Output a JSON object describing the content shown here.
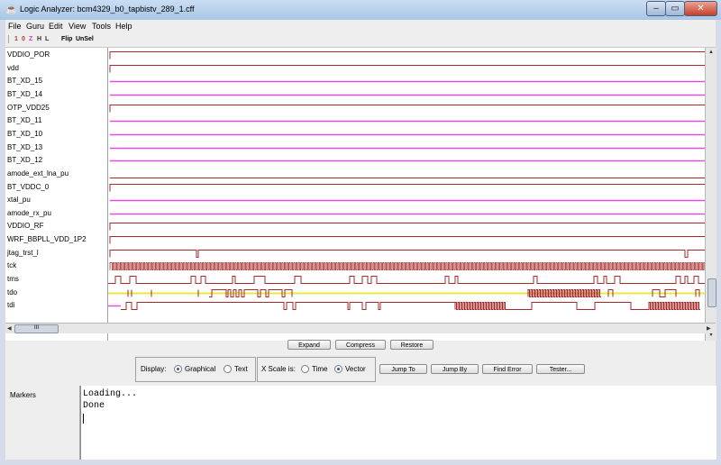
{
  "window": {
    "title": "Logic Analyzer: bcm4329_b0_tapbistv_289_1.cff",
    "controls": {
      "minimize": "‒",
      "maximize": "▭",
      "close": "✕"
    }
  },
  "menu": [
    "File",
    "Guru",
    "Edit",
    "View",
    "Tools",
    "Help"
  ],
  "toolbar": {
    "items": [
      {
        "label": "1",
        "color": "#b0392a"
      },
      {
        "label": "0",
        "color": "#b0392a"
      },
      {
        "label": "Z",
        "color": "#d040d0"
      },
      {
        "label": "H",
        "color": "#303030"
      },
      {
        "label": "L",
        "color": "#303030"
      },
      {
        "label": "Flip",
        "color": "#000000"
      },
      {
        "label": "UnSel",
        "color": "#000000"
      }
    ]
  },
  "signals": [
    {
      "name": "VDDIO_POR",
      "kind": "rise"
    },
    {
      "name": "vdd",
      "kind": "rise"
    },
    {
      "name": "BT_XD_15",
      "kind": "z"
    },
    {
      "name": "BT_XD_14",
      "kind": "z"
    },
    {
      "name": "OTP_VDD25",
      "kind": "rise"
    },
    {
      "name": "BT_XD_11",
      "kind": "z"
    },
    {
      "name": "BT_XD_10",
      "kind": "z"
    },
    {
      "name": "BT_XD_13",
      "kind": "z"
    },
    {
      "name": "BT_XD_12",
      "kind": "z"
    },
    {
      "name": "amode_ext_lna_pu",
      "kind": "low"
    },
    {
      "name": "BT_VDDC_0",
      "kind": "rise"
    },
    {
      "name": "xtal_pu",
      "kind": "z"
    },
    {
      "name": "amode_rx_pu",
      "kind": "z"
    },
    {
      "name": "VDDIO_RF",
      "kind": "rise"
    },
    {
      "name": "WRF_BBPLL_VDD_1P2",
      "kind": "rise"
    },
    {
      "name": "jtag_trst_l",
      "kind": "trst"
    },
    {
      "name": "tck",
      "kind": "clock"
    },
    {
      "name": "tms",
      "kind": "tms"
    },
    {
      "name": "tdo",
      "kind": "tdo"
    },
    {
      "name": "tdi",
      "kind": "tdi"
    }
  ],
  "colors": {
    "wave": "#a52a2a",
    "z": "#e050e0",
    "x": "#e8e840"
  },
  "buttons": {
    "expand": "Expand",
    "compress": "Compress",
    "restore": "Restore",
    "jump_to": "Jump To",
    "jump_by": "Jump By",
    "find_error": "Find Error",
    "tester": "Tester..."
  },
  "display": {
    "label": "Display:",
    "options": [
      "Graphical",
      "Text"
    ],
    "selected": "Graphical"
  },
  "xscale": {
    "label": "X Scale is:",
    "options": [
      "Time",
      "Vector"
    ],
    "selected": "Vector"
  },
  "markers_label": "Markers",
  "console": [
    "Loading...",
    "Done"
  ],
  "scroll": {
    "h_thumb": "III"
  }
}
